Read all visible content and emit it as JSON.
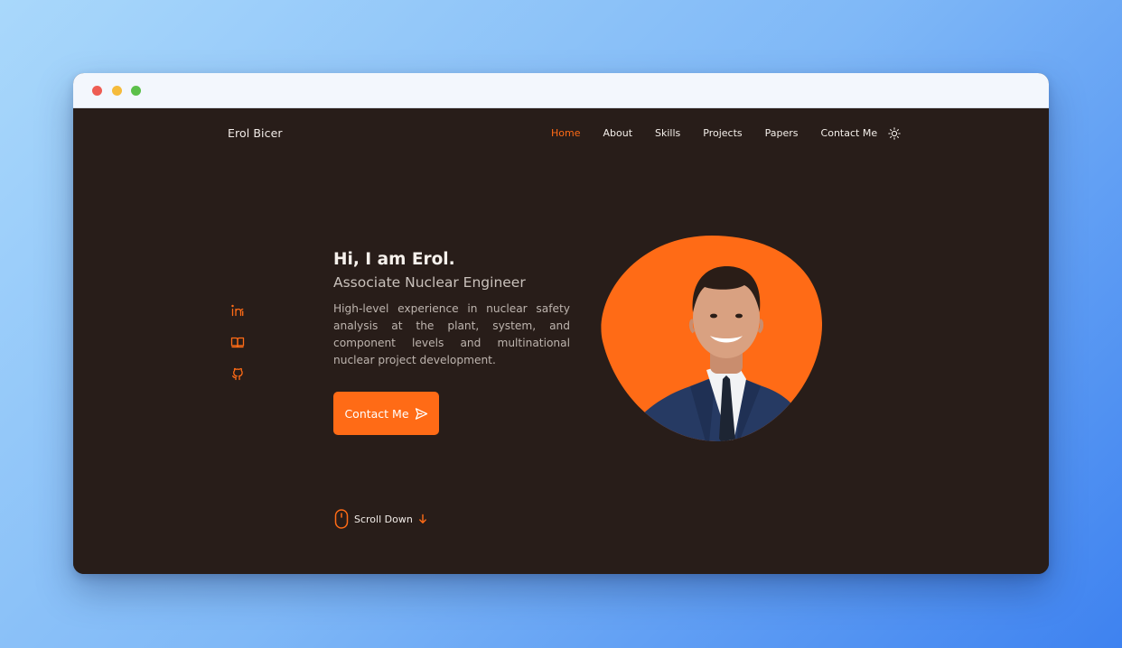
{
  "window": {
    "controls": [
      "close",
      "minimize",
      "maximize"
    ]
  },
  "brand": "Erol Bicer",
  "nav": {
    "items": [
      {
        "label": "Home",
        "active": true
      },
      {
        "label": "About",
        "active": false
      },
      {
        "label": "Skills",
        "active": false
      },
      {
        "label": "Projects",
        "active": false
      },
      {
        "label": "Papers",
        "active": false
      },
      {
        "label": "Contact Me",
        "active": false
      }
    ],
    "theme_toggle_icon": "sun-icon"
  },
  "socials": [
    {
      "icon": "linkedin-icon"
    },
    {
      "icon": "book-icon"
    },
    {
      "icon": "github-icon"
    }
  ],
  "hero": {
    "greeting": "Hi, I am Erol.",
    "role": "Associate Nuclear Engineer",
    "description": "High-level experience in nuclear safety analysis at the plant, system, and component levels and multinational nuclear project development.",
    "cta_label": "Contact Me",
    "cta_icon": "send-icon"
  },
  "scroll": {
    "label": "Scroll Down",
    "icon": "mouse-icon",
    "arrow_icon": "arrow-down-icon"
  },
  "colors": {
    "accent": "#ff6b16",
    "background": "#281d19",
    "text": "#f4efea",
    "muted": "#bdb4ae"
  }
}
